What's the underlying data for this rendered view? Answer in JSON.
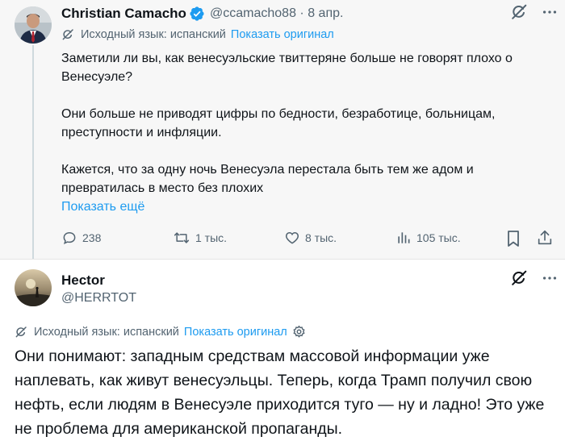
{
  "tweet1": {
    "author_name": "Christian Camacho",
    "handle": "@ccamacho88",
    "separator": "·",
    "date": "8 апр.",
    "translation_label": "Исходный язык: испанский",
    "show_original": "Показать оригинал",
    "paragraphs": [
      "Заметили ли вы, как венесуэльские твиттеряне больше не говорят плохо о Венесуэле?",
      "Они больше не приводят цифры по бедности, безработице, больницам, преступности и инфляции.",
      "Кажется, что за одну ночь Венесуэла перестала быть тем же адом и превратилась в место без плохих"
    ],
    "show_more": "Показать ещё",
    "replies": "238",
    "retweets": "1 тыс.",
    "likes": "8 тыс.",
    "views": "105 тыс."
  },
  "tweet2": {
    "author_name": "Hector",
    "handle": "@HERRTOT",
    "translation_label": "Исходный язык: испанский",
    "show_original": "Показать оригинал",
    "text": "Они понимают: западным средствам массовой информации уже наплевать, как живут венесуэльцы. Теперь, когда Трамп получил свою нефть, если людям в Венесуэле приходится туго — ну и ладно! Это уже не проблема для американской пропаганды."
  },
  "colors": {
    "link": "#1d9bf0",
    "muted": "#536471",
    "text": "#0f1419",
    "tweet1_bg": "#f7f7f7"
  }
}
